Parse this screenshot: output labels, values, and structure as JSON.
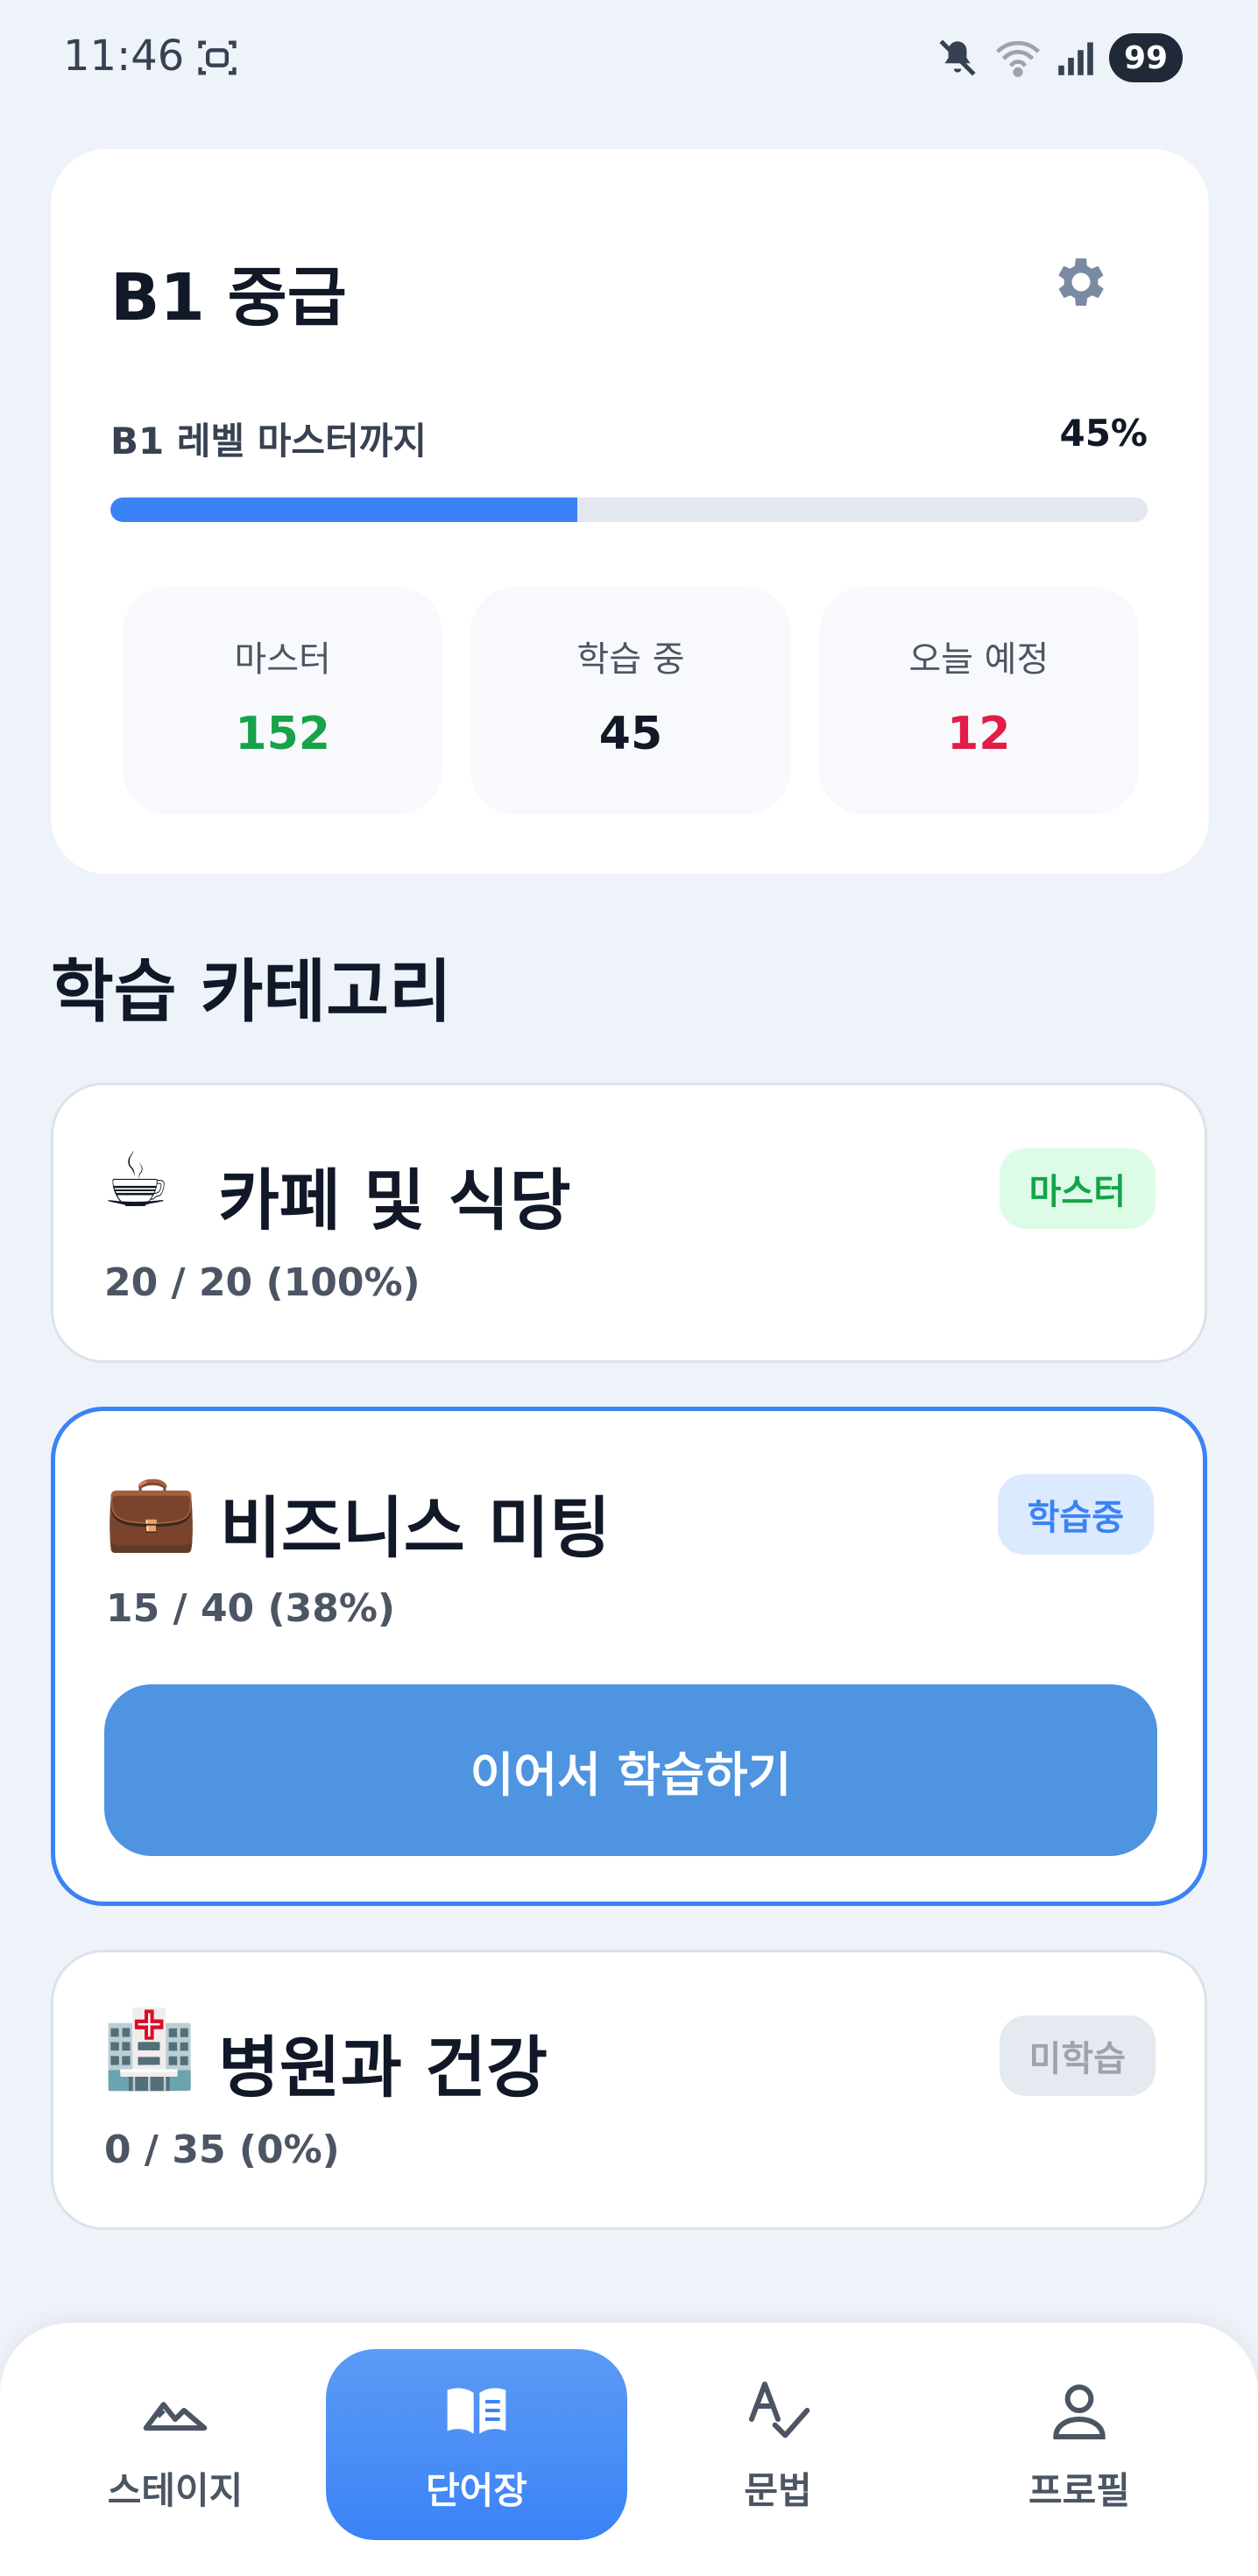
{
  "status": {
    "time": "11:46",
    "battery": "99"
  },
  "level": {
    "title": "B1 중급",
    "progress_label": "B1 레벨 마스터까지",
    "progress_percent_text": "45%",
    "progress_fraction": 0.45,
    "stats": [
      {
        "label": "마스터",
        "value": "152",
        "color": "#16a34a"
      },
      {
        "label": "학습 중",
        "value": "45",
        "color": "#111827"
      },
      {
        "label": "오늘 예정",
        "value": "12",
        "color": "#e11d48"
      }
    ]
  },
  "section": {
    "title": "학습 카테고리"
  },
  "categories": [
    {
      "emoji": "☕",
      "title": "카페 및 식당",
      "count": "20 / 20 (100%)",
      "badge": "마스터",
      "badge_bg": "#dcfce7",
      "badge_color": "#16a34a"
    },
    {
      "emoji": "💼",
      "title": "비즈니스 미팅",
      "count": "15 / 40 (38%)",
      "badge": "학습중",
      "badge_bg": "#dbeafe",
      "badge_color": "#3b82f6",
      "button": "이어서 학습하기"
    },
    {
      "emoji": "🏥",
      "title": "병원과 건강",
      "count": "0 / 35 (0%)",
      "badge": "미학습",
      "badge_bg": "#e5e9f0",
      "badge_color": "#9ca3af"
    }
  ],
  "nav": {
    "items": [
      {
        "label": "스테이지",
        "icon": "mountain-icon"
      },
      {
        "label": "단어장",
        "icon": "book-icon"
      },
      {
        "label": "문법",
        "icon": "spellcheck-icon"
      },
      {
        "label": "프로필",
        "icon": "person-icon"
      }
    ],
    "active_index": 1
  }
}
